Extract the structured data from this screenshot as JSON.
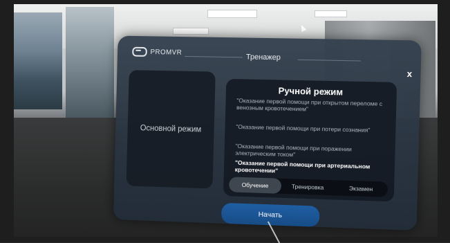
{
  "brand": {
    "logo_text": "PROMVR"
  },
  "panel": {
    "title": "Тренажер",
    "close_label": "x"
  },
  "modes": {
    "basic": {
      "label": "Основной режим"
    },
    "manual": {
      "title": "Ручной режим",
      "scenarios": [
        {
          "text": "\"Оказание первой помощи при открытом переломе с венозным кровотечением\"",
          "selected": false
        },
        {
          "text": "\"Оказание первой помощи при потери сознания\"",
          "selected": false
        },
        {
          "text": "\"Оказание первой помощи при поражении электрическим током\"",
          "selected": false
        },
        {
          "text": "\"Оказание первой помощи при артериальном кровотечении\"",
          "selected": true
        }
      ],
      "tabs": [
        {
          "label": "Обучение",
          "active": true
        },
        {
          "label": "Тренировка",
          "active": false
        },
        {
          "label": "Экзамен",
          "active": false
        }
      ]
    }
  },
  "actions": {
    "start_label": "Начать"
  },
  "colors": {
    "start_button": "#1f5ea3",
    "panel_bg": "#34404e",
    "card_bg": "#141a22"
  }
}
